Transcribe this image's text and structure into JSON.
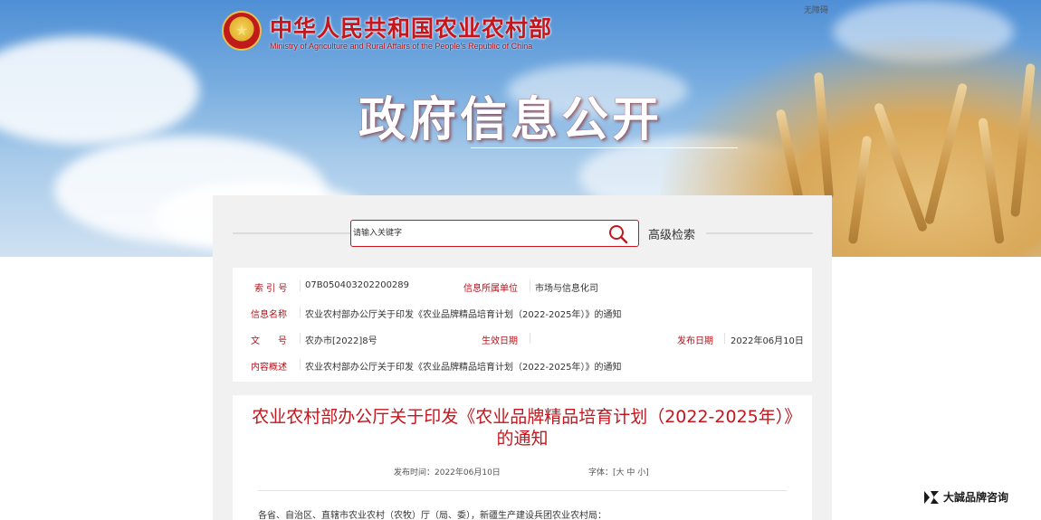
{
  "header": {
    "ministry_cn": "中华人民共和国农业农村部",
    "ministry_en": "Ministry of Agriculture and Rural Affairs of the People's Republic of China",
    "barrier_free": "无障碍",
    "banner_title": "政府信息公开",
    "emblem_icon": "national-emblem-icon"
  },
  "search": {
    "placeholder": "请输入关键字",
    "advanced_label": "高级检索"
  },
  "info": {
    "index_label": "索 引 号",
    "index_value": "07B050403202200289",
    "dept_label": "信息所属单位",
    "dept_value": "市场与信息化司",
    "name_label": "信息名称",
    "name_value": "农业农村部办公厅关于印发《农业品牌精品培育计划（2022-2025年）》的通知",
    "doc_label": "文　　号",
    "doc_value": "农办市[2022]8号",
    "effective_label": "生效日期",
    "effective_value": "",
    "publish_label": "发布日期",
    "publish_value": "2022年06月10日",
    "summary_label": "内容概述",
    "summary_value": "农业农村部办公厅关于印发《农业品牌精品培育计划（2022-2025年）》的通知"
  },
  "article": {
    "title": "农业农村部办公厅关于印发《农业品牌精品培育计划（2022-2025年）》的通知",
    "publish_time": "发布时间：2022年06月10日",
    "font_size": "字体：[大 中 小]",
    "body_first_line": "各省、自治区、直辖市农业农村（农牧）厅（局、委），新疆生产建设兵团农业农村局："
  },
  "watermark": {
    "text": "大誠品牌咨询"
  },
  "colors": {
    "brand_red": "#c4161c",
    "label_red": "#b5121b",
    "panel_bg": "#f1f1f1"
  }
}
